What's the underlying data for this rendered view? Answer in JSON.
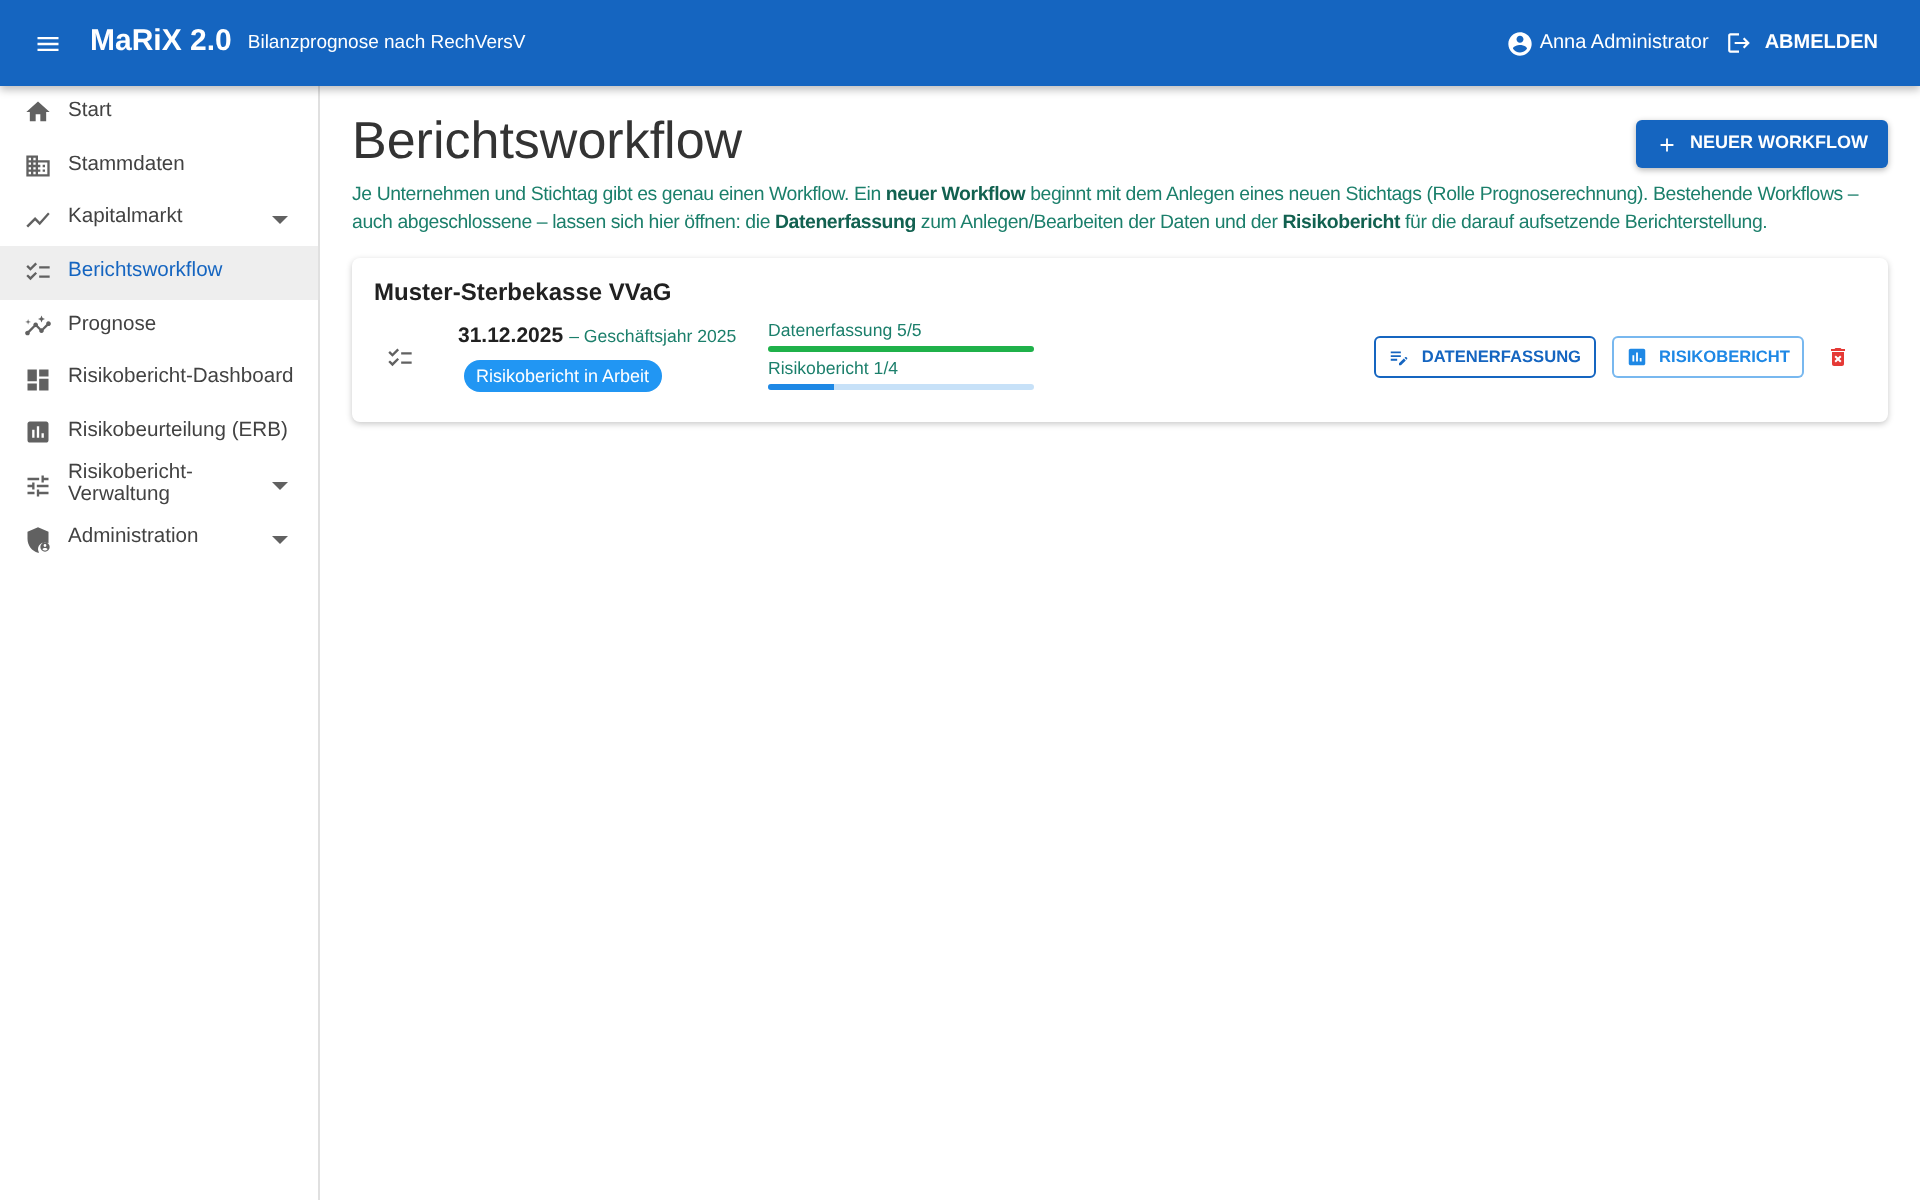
{
  "app_bar": {
    "title": "MaRiX 2.0",
    "subtitle": "Bilanzprognose nach RechVersV",
    "user": "Anna Administrator",
    "logout": "ABMELDEN"
  },
  "sidebar": {
    "items": [
      {
        "label": "Start",
        "selected": false
      },
      {
        "label": "Stammdaten",
        "selected": false
      },
      {
        "label": "Kapitalmarkt",
        "selected": false,
        "expanded": false
      },
      {
        "label": "Berichtsworkflow",
        "selected": true
      },
      {
        "label": "Prognose",
        "selected": false
      },
      {
        "label": "Risikobericht-Dashboard",
        "selected": false
      },
      {
        "label": "Risikobeurteilung (ERB)",
        "selected": false
      },
      {
        "label": "Risikobericht-Verwaltung",
        "selected": false,
        "expanded": false
      },
      {
        "label": "Administration",
        "selected": false,
        "expanded": false
      }
    ]
  },
  "page": {
    "title": "Berichtsworkflow",
    "new_button": "NEUER WORKFLOW",
    "description": "Je Unternehmen und Stichtag gibt es genau einen Workflow. Ein **neuer Workflow** beginnt mit dem Anlegen eines neuen Stichtags (Rolle Prognoserechnung). Bestehende Workflows – auch abgeschlossene – lassen sich hier öffnen: die **Datenerfassung** zum Anlegen/Bearbeiten der Daten und der **Risikobericht** für die darauf aufsetzende Berichterstellung."
  },
  "workflows": [
    {
      "company": "Muster-Sterbekasse VVaG",
      "date": "31.12.2025",
      "fiscal_year": "– Geschäftsjahr 2025",
      "status": "Risikobericht in Arbeit",
      "progress": [
        {
          "label": "Datenerfassung 5/5",
          "level": 1,
          "color": "#1fb14a"
        },
        {
          "label": "Risikobericht 1/4",
          "level": 0.25,
          "color": "#1e88e5"
        }
      ],
      "actions": [
        {
          "label": "DATENERFASSUNG",
          "color": "#1565c0"
        },
        {
          "label": "RISIKOBERICHT",
          "color": "#1e88e5"
        }
      ]
    }
  ]
}
